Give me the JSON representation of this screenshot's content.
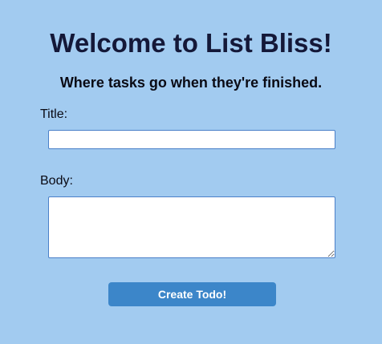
{
  "header": {
    "title": "Welcome to List Bliss!",
    "subtitle": "Where tasks go when they're finished."
  },
  "form": {
    "title_label": "Title:",
    "title_value": "",
    "body_label": "Body:",
    "body_value": "",
    "submit_label": "Create Todo!"
  },
  "colors": {
    "background": "#a2cbf0",
    "button": "#3c86c9",
    "heading": "#141838"
  }
}
